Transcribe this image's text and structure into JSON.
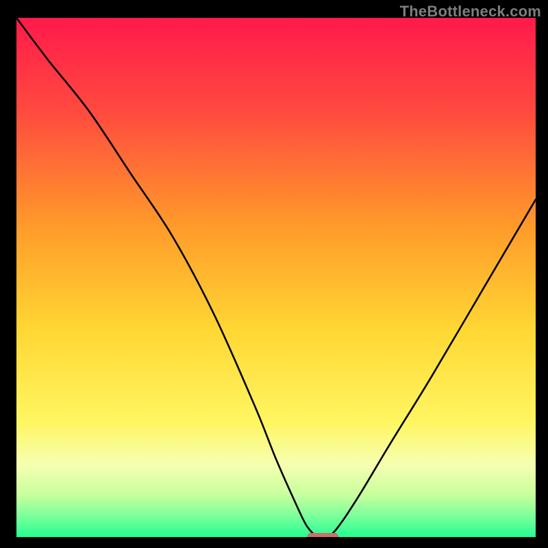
{
  "watermark": {
    "text": "TheBottleneck.com"
  },
  "chart_data": {
    "type": "line",
    "title": "",
    "xlabel": "",
    "ylabel": "",
    "xlim": [
      0,
      100
    ],
    "ylim": [
      0,
      100
    ],
    "grid": false,
    "legend": false,
    "background_gradient": {
      "stops": [
        {
          "offset": 0.0,
          "color": "#ff1a4b"
        },
        {
          "offset": 0.18,
          "color": "#ff4a3f"
        },
        {
          "offset": 0.4,
          "color": "#ff9a2a"
        },
        {
          "offset": 0.6,
          "color": "#ffd733"
        },
        {
          "offset": 0.78,
          "color": "#fff662"
        },
        {
          "offset": 0.86,
          "color": "#f6ffb0"
        },
        {
          "offset": 0.92,
          "color": "#c7ff9d"
        },
        {
          "offset": 0.97,
          "color": "#66ff9a"
        },
        {
          "offset": 1.0,
          "color": "#23ff90"
        }
      ]
    },
    "series": [
      {
        "name": "bottleneck-curve",
        "x": [
          0,
          6,
          14,
          22,
          30,
          38,
          46,
          50,
          54,
          56,
          58,
          59,
          60,
          62,
          66,
          72,
          80,
          90,
          100
        ],
        "y": [
          100,
          92,
          82,
          70,
          58,
          43,
          25,
          15,
          6,
          2,
          0,
          0,
          0,
          2,
          8,
          18,
          31,
          48,
          65
        ]
      }
    ],
    "marker": {
      "name": "optimal-marker",
      "x_range": [
        56,
        62
      ],
      "y": 0,
      "color": "#cc6f6b"
    }
  }
}
